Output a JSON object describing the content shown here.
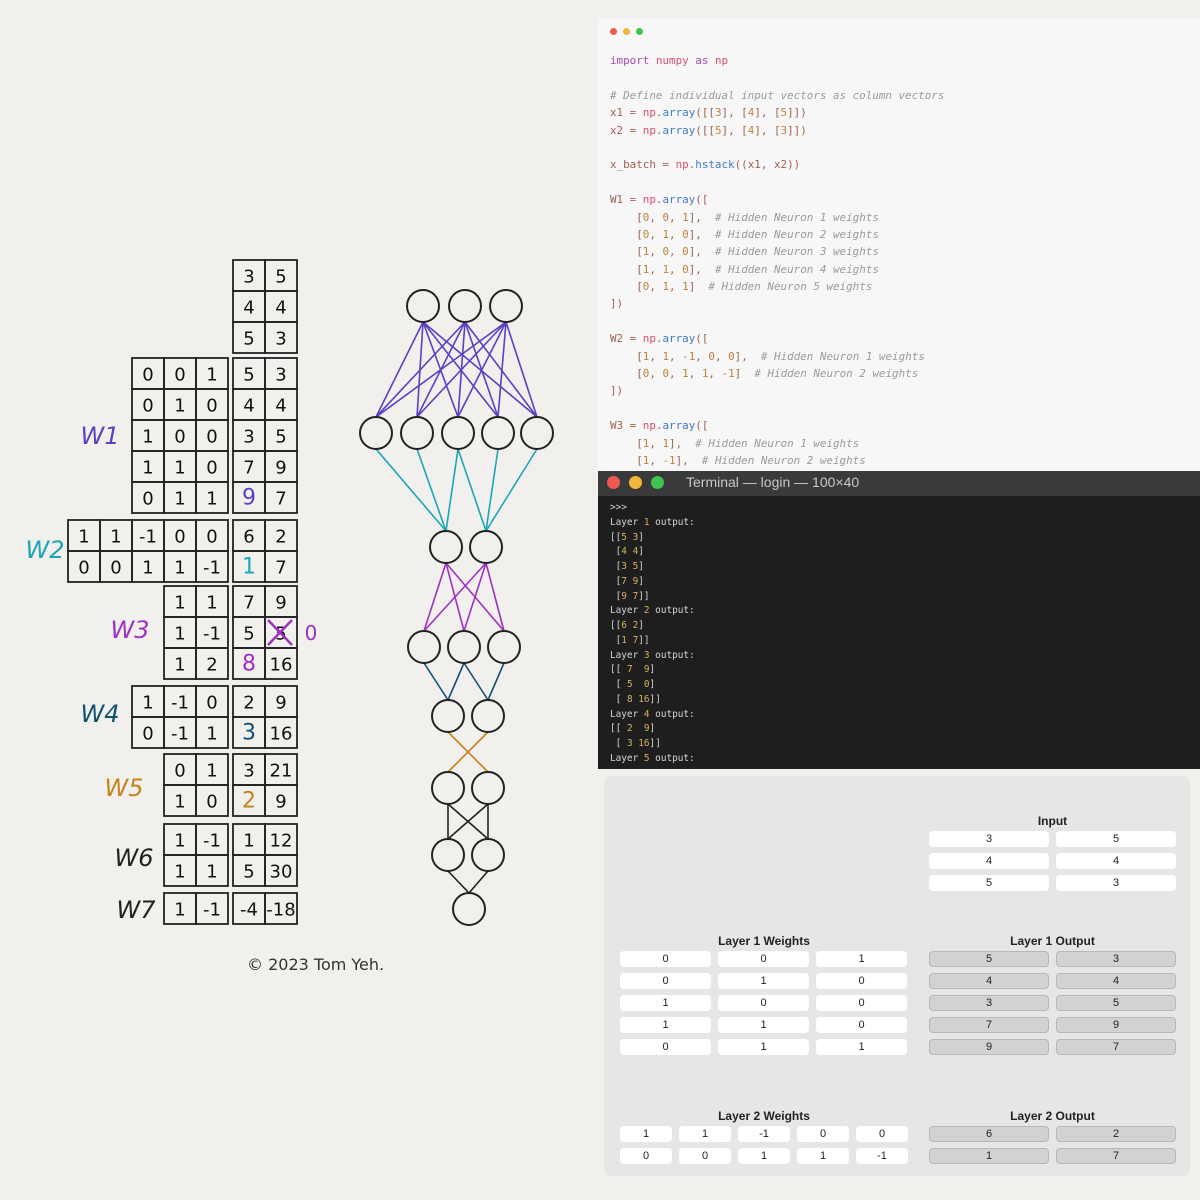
{
  "drawing": {
    "input": [
      [
        3,
        5
      ],
      [
        4,
        4
      ],
      [
        5,
        3
      ]
    ],
    "w1": [
      [
        0,
        0,
        1
      ],
      [
        0,
        1,
        0
      ],
      [
        1,
        0,
        0
      ],
      [
        1,
        1,
        0
      ],
      [
        0,
        1,
        1
      ]
    ],
    "l1": [
      [
        5,
        3
      ],
      [
        4,
        4
      ],
      [
        3,
        5
      ],
      [
        7,
        9
      ],
      [
        9,
        7
      ]
    ],
    "w2": [
      [
        1,
        1,
        -1,
        0,
        0
      ],
      [
        0,
        0,
        1,
        1,
        -1
      ]
    ],
    "l2": [
      [
        6,
        2
      ],
      [
        1,
        7
      ]
    ],
    "w3": [
      [
        1,
        1
      ],
      [
        1,
        -1
      ],
      [
        1,
        2
      ]
    ],
    "l3": [
      [
        7,
        9
      ],
      [
        5,
        5
      ],
      [
        8,
        16
      ]
    ],
    "w4": [
      [
        1,
        -1,
        0
      ],
      [
        0,
        -1,
        1
      ]
    ],
    "l4": [
      [
        2,
        9
      ],
      [
        3,
        16
      ]
    ],
    "w5": [
      [
        0,
        1
      ],
      [
        1,
        0
      ]
    ],
    "l5": [
      [
        3,
        21
      ],
      [
        2,
        9
      ]
    ],
    "w6": [
      [
        1,
        -1
      ],
      [
        1,
        1
      ]
    ],
    "l6": [
      [
        1,
        12
      ],
      [
        5,
        30
      ]
    ],
    "w7": [
      [
        1,
        -1
      ]
    ],
    "l7": [
      [
        -4,
        -18
      ]
    ],
    "labels": {
      "w1": "W1",
      "w2": "W2",
      "w3": "W3",
      "w4": "W4",
      "w5": "W5",
      "w6": "W6",
      "w7": "W7"
    },
    "relu_fix": "0",
    "copyright": "© 2023 Tom Yeh.",
    "colors": {
      "w1": "#5b3fc4",
      "w2": "#1aa6b7",
      "w3": "#a02fc4",
      "w4": "#114f73",
      "w5": "#c8821c",
      "w6": "#222222",
      "w7": "#222222"
    }
  },
  "code": {
    "lines": [
      "import numpy as np",
      "",
      "# Define individual input vectors as column vectors",
      "x1 = np.array([[3], [4], [5]])",
      "x2 = np.array([[5], [4], [3]])",
      "",
      "x_batch = np.hstack((x1, x2))",
      "",
      "W1 = np.array([",
      "    [0, 0, 1],  # Hidden Neuron 1 weights",
      "    [0, 1, 0],  # Hidden Neuron 2 weights",
      "    [1, 0, 0],  # Hidden Neuron 3 weights",
      "    [1, 1, 0],  # Hidden Neuron 4 weights",
      "    [0, 1, 1]  # Hidden Neuron 5 weights",
      "])",
      "",
      "W2 = np.array([",
      "    [1, 1, -1, 0, 0],  # Hidden Neuron 1 weights",
      "    [0, 0, 1, 1, -1]  # Hidden Neuron 2 weights",
      "])",
      "",
      "W3 = np.array([",
      "    [1, 1],  # Hidden Neuron 1 weights",
      "    [1, -1],  # Hidden Neuron 2 weights"
    ]
  },
  "terminal": {
    "title": "Terminal — login — 100×40",
    "lines": [
      ">>>",
      "Layer 1 output:",
      "[[5 3]",
      " [4 4]",
      " [3 5]",
      " [7 9]",
      " [9 7]]",
      "Layer 2 output:",
      "[[6 2]",
      " [1 7]]",
      "Layer 3 output:",
      "[[ 7  9]",
      " [ 5  0]",
      " [ 8 16]]",
      "Layer 4 output:",
      "[[ 2  9]",
      " [ 3 16]]",
      "Layer 5 output:"
    ]
  },
  "gui": {
    "input_title": "Input",
    "input": [
      [
        "3",
        "5"
      ],
      [
        "4",
        "4"
      ],
      [
        "5",
        "3"
      ]
    ],
    "l1w_title": "Layer 1 Weights",
    "l1w": [
      [
        "0",
        "0",
        "1"
      ],
      [
        "0",
        "1",
        "0"
      ],
      [
        "1",
        "0",
        "0"
      ],
      [
        "1",
        "1",
        "0"
      ],
      [
        "0",
        "1",
        "1"
      ]
    ],
    "l1o_title": "Layer 1 Output",
    "l1o": [
      [
        "5",
        "3"
      ],
      [
        "4",
        "4"
      ],
      [
        "3",
        "5"
      ],
      [
        "7",
        "9"
      ],
      [
        "9",
        "7"
      ]
    ],
    "l2w_title": "Layer 2 Weights",
    "l2w": [
      [
        "1",
        "1",
        "-1",
        "0",
        "0"
      ],
      [
        "0",
        "0",
        "1",
        "1",
        "-1"
      ]
    ],
    "l2o_title": "Layer 2 Output",
    "l2o": [
      [
        "6",
        "2"
      ],
      [
        "1",
        "7"
      ]
    ]
  }
}
